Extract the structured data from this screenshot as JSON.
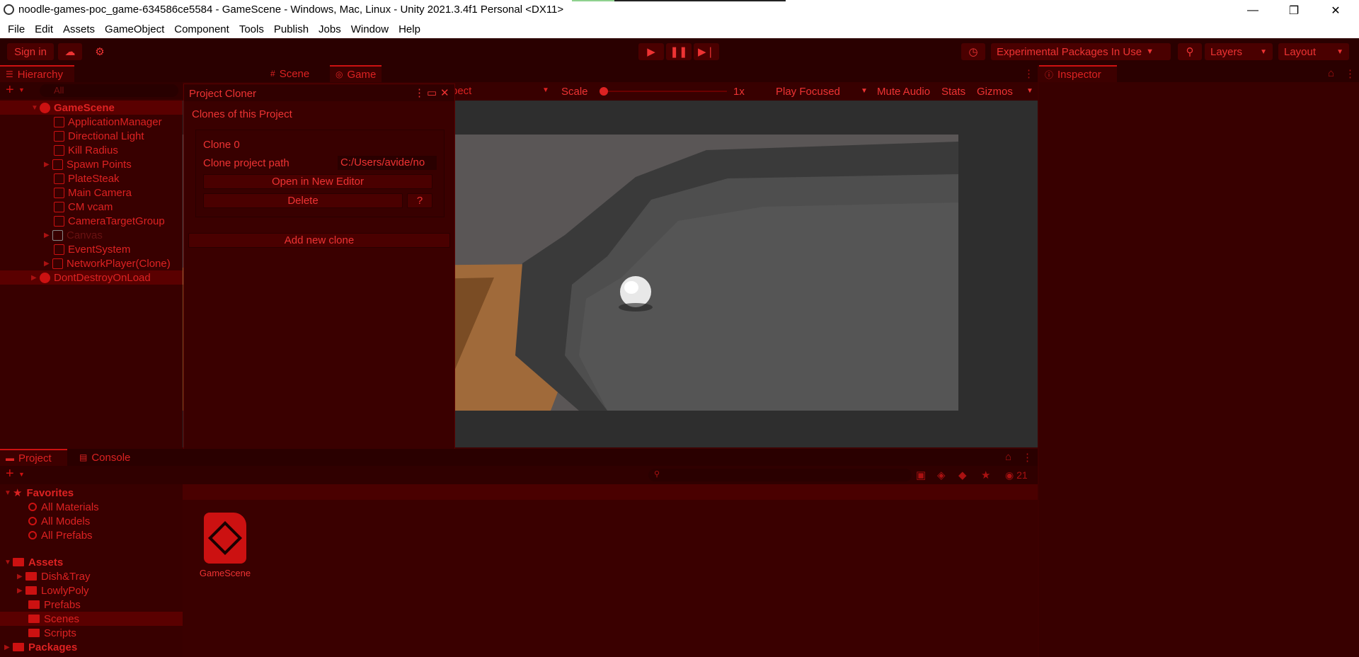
{
  "window": {
    "title": "noodle-games-poc_game-634586ce5584 - GameScene - Windows, Mac, Linux - Unity 2021.3.4f1 Personal <DX11>",
    "minimize": "—",
    "maximize": "❐",
    "close": "✕"
  },
  "menu": [
    "File",
    "Edit",
    "Assets",
    "GameObject",
    "Component",
    "Tools",
    "Publish",
    "Jobs",
    "Window",
    "Help"
  ],
  "toolbar": {
    "sign_in": "Sign in",
    "packages": "Experimental Packages In Use",
    "layers": "Layers",
    "layout": "Layout"
  },
  "hierarchy": {
    "tab": "Hierarchy",
    "search_placeholder": "All",
    "items": [
      {
        "label": "GameScene"
      },
      {
        "label": "ApplicationManager"
      },
      {
        "label": "Directional Light"
      },
      {
        "label": "Kill Radius"
      },
      {
        "label": "Spawn Points"
      },
      {
        "label": "PlateSteak"
      },
      {
        "label": "Main Camera"
      },
      {
        "label": "CM vcam"
      },
      {
        "label": "CameraTargetGroup"
      },
      {
        "label": "Canvas"
      },
      {
        "label": "EventSystem"
      },
      {
        "label": "NetworkPlayer(Clone)"
      },
      {
        "label": "DontDestroyOnLoad"
      }
    ]
  },
  "scene_tabs": {
    "scene": "Scene",
    "game": "Game"
  },
  "game_toolbar": {
    "aspect": "pect",
    "scale_label": "Scale",
    "scale_value": "1x",
    "play_focused": "Play Focused",
    "mute_audio": "Mute Audio",
    "stats": "Stats",
    "gizmos": "Gizmos"
  },
  "inspector": {
    "tab": "Inspector"
  },
  "project_cloner": {
    "title": "Project Cloner",
    "section": "Clones of this Project",
    "clone_name": "Clone 0",
    "path_label": "Clone project path",
    "path_value": "C:/Users/avide/no",
    "open_button": "Open in New Editor",
    "delete_button": "Delete",
    "help_button": "?",
    "add_button": "Add new clone"
  },
  "project": {
    "tab": "Project",
    "console_tab": "Console",
    "hidden_count": "21",
    "favorites": {
      "label": "Favorites",
      "items": [
        "All Materials",
        "All Models",
        "All Prefabs"
      ]
    },
    "assets": {
      "label": "Assets",
      "items": [
        "Dish&Tray",
        "LowlyPoly",
        "Prefabs",
        "Scenes",
        "Scripts"
      ]
    },
    "packages": "Packages",
    "asset_file": "GameScene"
  }
}
